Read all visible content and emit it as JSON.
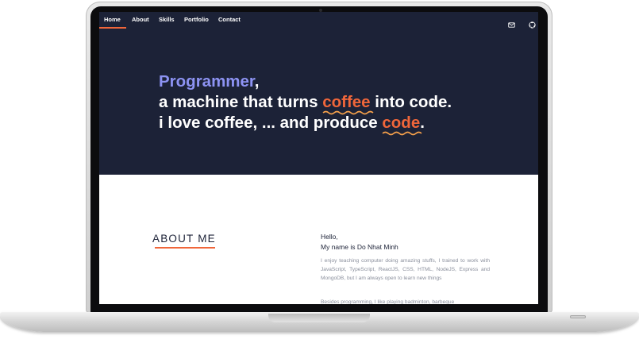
{
  "nav": {
    "items": [
      "Home",
      "About",
      "Skills",
      "Portfolio",
      "Contact"
    ],
    "active": "Home",
    "icons": [
      "mail-icon",
      "github-icon"
    ]
  },
  "hero": {
    "word_programmer": "Programmer",
    "comma": ",",
    "line2_before": "a machine that turns ",
    "line2_coffee": "coffee",
    "line2_after": " into code.",
    "line3_before": "i love coffee, ... and produce ",
    "line3_code": "code",
    "line3_period": "."
  },
  "about": {
    "title": "ABOUT ME",
    "hello": "Hello,",
    "name_line": "My name is Do Nhat Minh",
    "paragraph1": "I enjoy teaching computer doing amazing stuffs, I trained to work with JavaScript, TypeScript, ReactJS, CSS, HTML, NodeJS, Express and MongoDB, but I am always open to learn new things",
    "paragraph2": "Besides programming, I like playing badminton, barbeque"
  },
  "colors": {
    "navy": "#1c2237",
    "accent_orange": "#f0663a",
    "accent_blue": "#8d93f3"
  }
}
